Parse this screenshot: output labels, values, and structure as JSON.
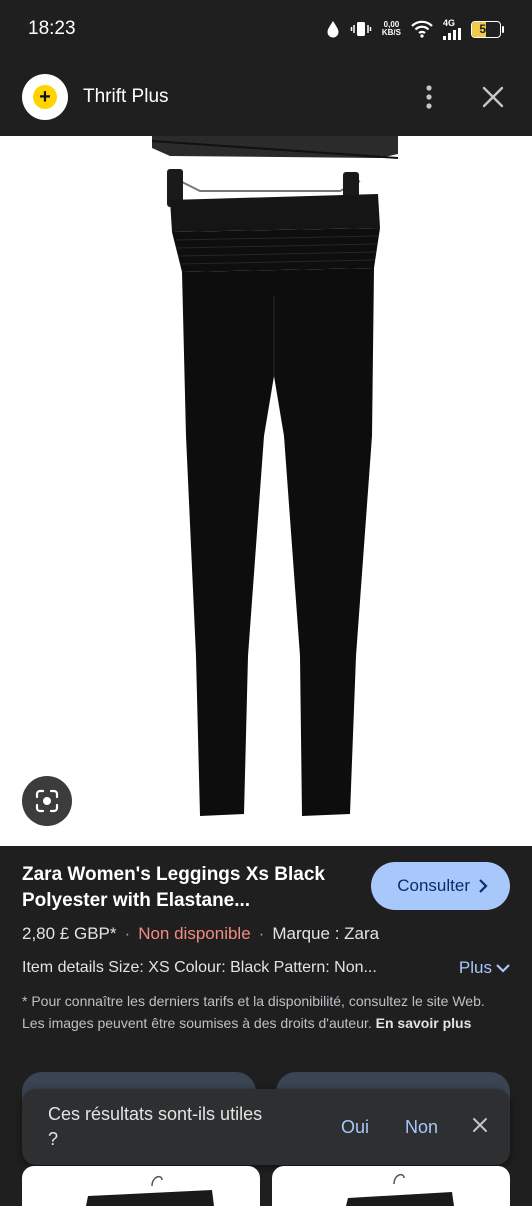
{
  "status": {
    "time": "18:23",
    "net_speed_value": "0,00",
    "net_speed_unit": "KB/S",
    "network": "4G",
    "battery": "51",
    "battery_level": 0.51
  },
  "app_bar": {
    "site_name": "Thrift Plus",
    "logo_glyph": "+"
  },
  "product": {
    "title": "Zara Women's Leggings Xs Black Polyester with Elastane...",
    "consult_label": "Consulter",
    "price": "2,80 £ GBP*",
    "separator": "·",
    "availability": "Non disponible",
    "brand": "Marque : Zara",
    "item_details": "Item details Size: XS Colour: Black Pattern: Non...",
    "more_label": "Plus",
    "disclaimer": "* Pour connaître les derniers tarifs et la disponibilité, consultez le site Web. Les images peuvent être soumises à des droits d'auteur.",
    "learn_more": "En savoir plus"
  },
  "feedback": {
    "question": "Ces résultats sont-ils utiles ?",
    "yes": "Oui",
    "no": "Non"
  },
  "colors": {
    "background": "#1f1f1f",
    "accent": "#a8c7fa",
    "unavailable": "#f28b82",
    "logo_yellow": "#ffd400"
  }
}
